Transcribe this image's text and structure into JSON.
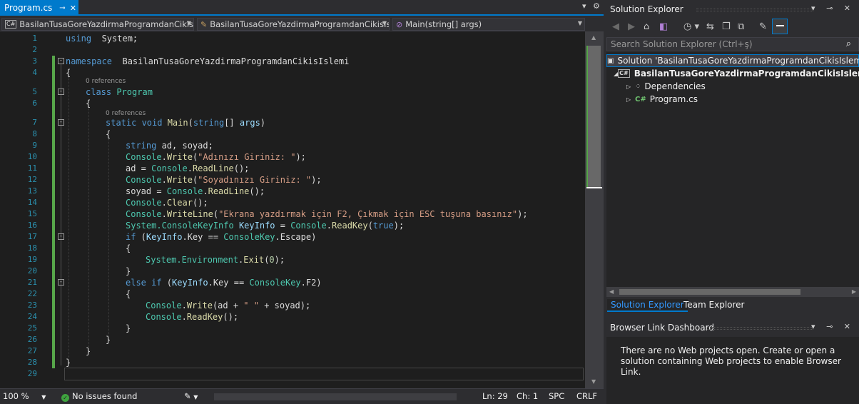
{
  "editor": {
    "tab": {
      "label": "Program.cs",
      "pin": "⊸",
      "close": "✕"
    },
    "tabstrip_dropdown": "▾",
    "tabstrip_gear": "⚙",
    "nav": {
      "project": "BasilanTusaGoreYazdirmaProgramdanCikisIsl",
      "type": "BasilanTusaGoreYazdirmaProgramdanCikisIsl",
      "member": "Main(string[] args)",
      "project_icon": "C#"
    },
    "references_text": "0 references",
    "line_numbers": [
      "1",
      "2",
      "3",
      "4",
      "5",
      "6",
      "7",
      "8",
      "9",
      "10",
      "11",
      "12",
      "13",
      "14",
      "15",
      "16",
      "17",
      "18",
      "19",
      "20",
      "21",
      "22",
      "23",
      "24",
      "25",
      "26",
      "27",
      "28",
      "29"
    ],
    "lines": [
      [
        [
          "k",
          "using"
        ],
        [
          "",
          "  System;"
        ]
      ],
      [],
      [
        [
          "k",
          "namespace"
        ],
        [
          "",
          "  BasilanTusaGoreYazdirmaProgramdanCikisIslemi"
        ]
      ],
      [
        [
          "",
          "{"
        ]
      ],
      [
        [
          "k",
          "class"
        ],
        [
          "t",
          " Program"
        ]
      ],
      [
        [
          "",
          "{"
        ]
      ],
      [
        [
          "k",
          "static void"
        ],
        [
          "m",
          " Main"
        ],
        [
          "",
          "("
        ],
        [
          "k",
          "string"
        ],
        [
          "",
          "[] "
        ],
        [
          "v",
          "args"
        ],
        [
          "",
          ")"
        ]
      ],
      [
        [
          "",
          "{"
        ]
      ],
      [
        [
          "k",
          "string"
        ],
        [
          "",
          " ad, soyad;"
        ]
      ],
      [
        [
          "t",
          "Console"
        ],
        [
          "",
          "."
        ],
        [
          "m",
          "Write"
        ],
        [
          "",
          "("
        ],
        [
          "s",
          "\"Adınızı Giriniz: \""
        ],
        [
          "",
          ");"
        ]
      ],
      [
        [
          "",
          "ad = "
        ],
        [
          "t",
          "Console"
        ],
        [
          "",
          "."
        ],
        [
          "m",
          "ReadLine"
        ],
        [
          "",
          "();"
        ]
      ],
      [
        [
          "t",
          "Console"
        ],
        [
          "",
          "."
        ],
        [
          "m",
          "Write"
        ],
        [
          "",
          "("
        ],
        [
          "s",
          "\"Soyadınızı Giriniz: \""
        ],
        [
          "",
          ");"
        ]
      ],
      [
        [
          "",
          "soyad = "
        ],
        [
          "t",
          "Console"
        ],
        [
          "",
          "."
        ],
        [
          "m",
          "ReadLine"
        ],
        [
          "",
          "();"
        ]
      ],
      [
        [
          "t",
          "Console"
        ],
        [
          "",
          "."
        ],
        [
          "m",
          "Clear"
        ],
        [
          "",
          "();"
        ]
      ],
      [
        [
          "t",
          "Console"
        ],
        [
          "",
          "."
        ],
        [
          "m",
          "WriteLine"
        ],
        [
          "",
          "("
        ],
        [
          "s",
          "\"Ekrana yazdırmak için F2, Çıkmak için ESC tuşuna basınız\""
        ],
        [
          "",
          ");"
        ]
      ],
      [
        [
          "t",
          "System.ConsoleKeyInfo"
        ],
        [
          "v",
          " KeyInfo"
        ],
        [
          "",
          " = "
        ],
        [
          "t",
          "Console"
        ],
        [
          "",
          "."
        ],
        [
          "m",
          "ReadKey"
        ],
        [
          "",
          "("
        ],
        [
          "k",
          "true"
        ],
        [
          "",
          ");"
        ]
      ],
      [
        [
          "k",
          "if"
        ],
        [
          "",
          " ("
        ],
        [
          "v",
          "KeyInfo"
        ],
        [
          "",
          ".Key == "
        ],
        [
          "t",
          "ConsoleKey"
        ],
        [
          "",
          ".Escape)"
        ]
      ],
      [
        [
          "",
          "{"
        ]
      ],
      [
        [
          "t",
          "System.Environment"
        ],
        [
          "",
          "."
        ],
        [
          "m",
          "Exit"
        ],
        [
          "",
          "("
        ],
        [
          "n",
          "0"
        ],
        [
          "",
          ");"
        ]
      ],
      [
        [
          "",
          "}"
        ]
      ],
      [
        [
          "k",
          "else if"
        ],
        [
          "",
          " ("
        ],
        [
          "v",
          "KeyInfo"
        ],
        [
          "",
          ".Key == "
        ],
        [
          "t",
          "ConsoleKey"
        ],
        [
          "",
          ".F2)"
        ]
      ],
      [
        [
          "",
          "{"
        ]
      ],
      [
        [
          "t",
          "Console"
        ],
        [
          "",
          "."
        ],
        [
          "m",
          "Write"
        ],
        [
          "",
          "(ad + "
        ],
        [
          "s",
          "\" \""
        ],
        [
          "",
          " + soyad);"
        ]
      ],
      [
        [
          "t",
          "Console"
        ],
        [
          "",
          "."
        ],
        [
          "m",
          "ReadKey"
        ],
        [
          "",
          "();"
        ]
      ],
      [
        [
          "",
          "}"
        ]
      ],
      [
        [
          "",
          "}"
        ]
      ],
      [
        [
          "",
          "}"
        ]
      ],
      [
        [
          "",
          "}"
        ]
      ],
      []
    ]
  },
  "status_bar": {
    "zoom": "100 %",
    "issues": "No issues found",
    "line": "Ln: 29",
    "col": "Ch: 1",
    "spacing": "SPC",
    "line_ending": "CRLF"
  },
  "solution_explorer": {
    "title": "Solution Explorer",
    "pane_buttons": "▾ ⊸ ✕",
    "search_placeholder": "Search Solution Explorer (Ctrl+ş)",
    "solution_label": "Solution 'BasilanTusaGoreYazdirmaProgramdanCikisIslemi'",
    "project_label": "BasilanTusaGoreYazdirmaProgramdanCikisIslemi",
    "dependencies_label": "Dependencies",
    "program_label": "Program.cs",
    "cs_icon": "C#",
    "tab_solution": "Solution Explorer",
    "tab_team": "Team Explorer"
  },
  "browser_link": {
    "title": "Browser Link Dashboard",
    "pane_buttons": "▾ ⊸ ✕",
    "message": "There are no Web projects open. Create or open a solution containing Web projects to enable Browser Link."
  },
  "colors": {
    "accent": "#007acc",
    "keyword": "#569cd6",
    "type": "#4ec9b0",
    "string": "#d69d85",
    "method": "#dcdcaa",
    "change_bar": "#57a64a"
  }
}
